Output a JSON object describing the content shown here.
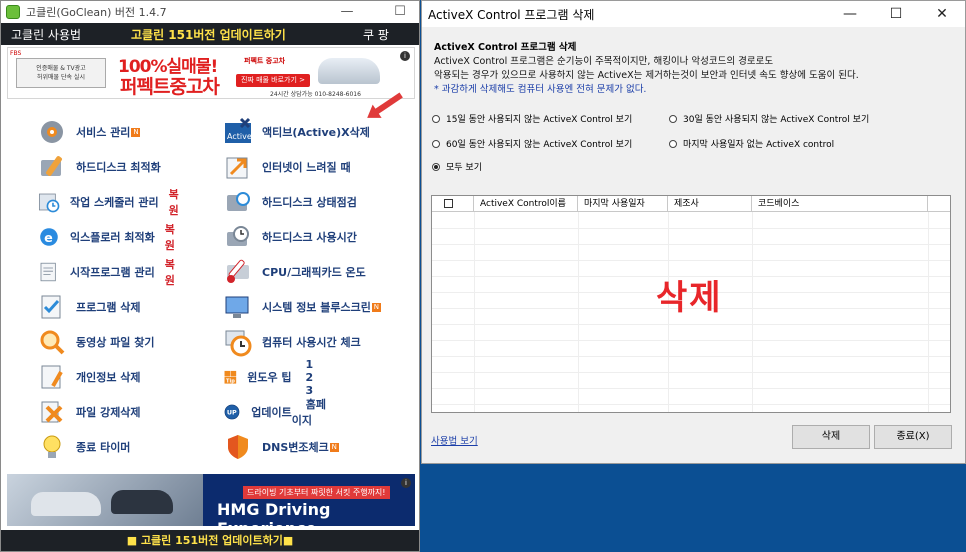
{
  "left_window": {
    "title": "고클린(GoClean) 버전 1.4.7",
    "controls": {
      "minimize": "—",
      "maximize": "☐"
    },
    "menubar": {
      "user_label": "고클린 사용법",
      "update_label": "고클린 151버전 업데이트하기",
      "coupon_label": "쿠 팡"
    },
    "top_ad": {
      "ad_mark": "FBS",
      "badge_line1": "인증매물 & TV광고",
      "badge_line2": "허위매물 단속 실시",
      "headline": "100%실매물!",
      "subline": "퍼펙트중고차",
      "brand": "퍼펙트 중고차",
      "cta": "진짜 매물 바로가기 >",
      "phone": "24시간 상담가능 010-8248-6016",
      "info": "i"
    },
    "tools_left": [
      {
        "label": "서비스 관리",
        "badge": "N",
        "restore": ""
      },
      {
        "label": "하드디스크 최적화",
        "badge": "",
        "restore": ""
      },
      {
        "label": "작업 스케줄러 관리",
        "badge": "",
        "restore": "복원"
      },
      {
        "label": "익스플로러 최적화",
        "badge": "",
        "restore": "복원"
      },
      {
        "label": "시작프로그램 관리",
        "badge": "",
        "restore": "복원"
      },
      {
        "label": "프로그램 삭제",
        "badge": "",
        "restore": ""
      },
      {
        "label": "동영상 파일 찾기",
        "badge": "",
        "restore": ""
      },
      {
        "label": "개인정보 삭제",
        "badge": "",
        "restore": ""
      },
      {
        "label": "파일 강제삭제",
        "badge": "",
        "restore": ""
      },
      {
        "label": "종료 타이머",
        "badge": "",
        "restore": ""
      }
    ],
    "tools_right": [
      {
        "label": "액티브(Active)X삭제",
        "badge": ""
      },
      {
        "label": "인터넷이 느려질 때",
        "badge": ""
      },
      {
        "label": "하드디스크 상태점검",
        "badge": ""
      },
      {
        "label": "하드디스크 사용시간",
        "badge": ""
      },
      {
        "label": "CPU/그래픽카드 온도",
        "badge": ""
      },
      {
        "label": "시스템 정보  블루스크린",
        "badge": "N"
      },
      {
        "label": "컴퓨터 사용시간 체크",
        "badge": ""
      },
      {
        "label": "윈도우 팁",
        "links": [
          "1",
          "2",
          "3"
        ]
      },
      {
        "label": "업데이트",
        "links": [
          "홈페이지"
        ]
      },
      {
        "label": "DNS변조체크",
        "badge": "N"
      }
    ],
    "icon_labels": {
      "activex": "Active",
      "tip": "Tip",
      "up": "UP"
    },
    "bottom_ad": {
      "tagline": "드라이빙 기초부터 짜릿한 서킷 주행까지!",
      "brandline": "HMG Driving Experience",
      "info": "i"
    },
    "footer": "■ 고클린 151버전 업데이트하기■"
  },
  "right_window": {
    "title": "ActiveX Control 프로그램 삭제",
    "controls": {
      "minimize": "—",
      "maximize": "☐",
      "close": "✕"
    },
    "heading": "ActiveX Control 프로그램 삭제",
    "desc_line1": "ActiveX Control 프로그램은 순기능이 주목적이지만, 해킹이나 악성코드의 경로로도",
    "desc_line2": "악용되는 경우가 있으므로 사용하지 않는 ActiveX는 제거하는것이 보안과 인터넷 속도 향상에 도움이 된다.",
    "note": "* 과감하게 삭제해도 컴퓨터 사용엔 전혀 문제가 없다.",
    "radios": [
      {
        "label": "15일 동안 사용되지 않는 ActiveX Control 보기",
        "checked": false
      },
      {
        "label": "30일 동안 사용되지 않는 ActiveX Control 보기",
        "checked": false
      },
      {
        "label": "60일 동안 사용되지 않는 ActiveX Control 보기",
        "checked": false
      },
      {
        "label": "마지막 사용일자 없는 ActiveX control",
        "checked": false
      },
      {
        "label": "모두 보기",
        "checked": true
      }
    ],
    "columns": [
      "ActiveX Control이름",
      "마지막 사용일자",
      "제조사",
      "코드베이스"
    ],
    "overlay_text": "삭제",
    "usage_link": "사용법 보기",
    "delete_button": "삭제",
    "close_button": "종료(X)"
  }
}
